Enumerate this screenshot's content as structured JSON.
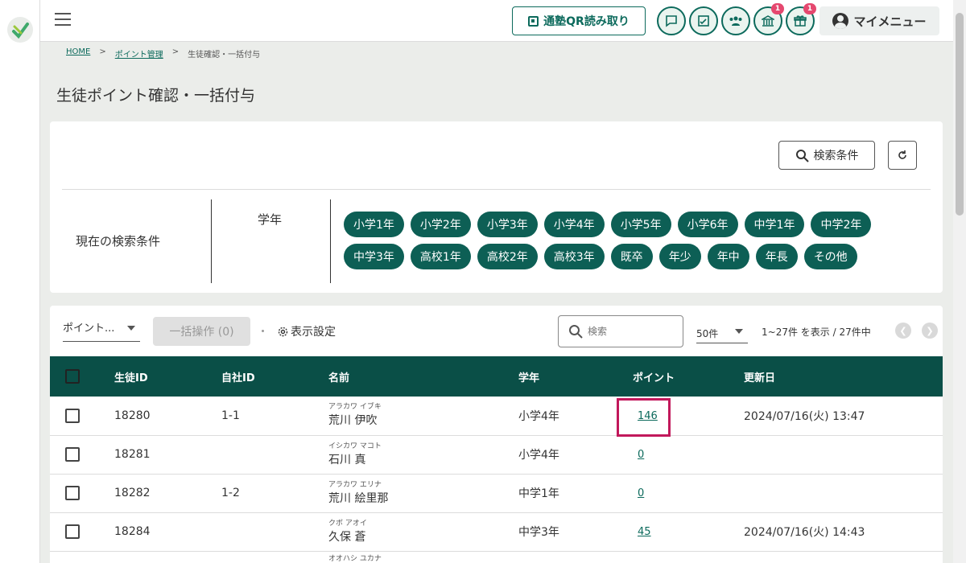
{
  "topbar": {
    "qr_button": "通塾QR読み取り",
    "badges": {
      "notice": "1",
      "gift": "1"
    },
    "my_menu": "マイメニュー"
  },
  "breadcrumb": {
    "home": "HOME",
    "sep": ">",
    "point_admin": "ポイント管理",
    "current": "生徒確認・一括付与"
  },
  "page_title": "生徒ポイント確認・一括付与",
  "filter": {
    "search_button": "検索条件",
    "current_label": "現在の検索条件",
    "grade_label": "学年",
    "grades": [
      "小学1年",
      "小学2年",
      "小学3年",
      "小学4年",
      "小学5年",
      "小学6年",
      "中学1年",
      "中学2年",
      "中学3年",
      "高校1年",
      "高校2年",
      "高校3年",
      "既卒",
      "年少",
      "年中",
      "年長",
      "その他"
    ]
  },
  "toolbar": {
    "point_select": "ポイント...",
    "bulk_button": "一括操作 (0)",
    "display_setting": "表示設定",
    "search_placeholder": "検索",
    "per_page": "50件",
    "range": "1~27件 を表示 / 27件中"
  },
  "table": {
    "headers": {
      "student_id": "生徒ID",
      "company_id": "自社ID",
      "name": "名前",
      "grade": "学年",
      "points": "ポイント",
      "updated": "更新日"
    },
    "rows": [
      {
        "student_id": "18280",
        "company_id": "1-1",
        "kana": "アラカワ イブキ",
        "name": "荒川 伊吹",
        "grade": "小学4年",
        "points": "146",
        "updated": "2024/07/16(火) 13:47"
      },
      {
        "student_id": "18281",
        "company_id": "",
        "kana": "イシカワ マコト",
        "name": "石川 真",
        "grade": "小学4年",
        "points": "0",
        "updated": ""
      },
      {
        "student_id": "18282",
        "company_id": "1-2",
        "kana": "アラカワ エリナ",
        "name": "荒川 絵里那",
        "grade": "中学1年",
        "points": "0",
        "updated": ""
      },
      {
        "student_id": "18284",
        "company_id": "",
        "kana": "クボ アオイ",
        "name": "久保 蒼",
        "grade": "中学3年",
        "points": "45",
        "updated": "2024/07/16(火) 14:43"
      },
      {
        "student_id": "",
        "company_id": "",
        "kana": "オオハシ ユカナ",
        "name": "",
        "grade": "",
        "points": "",
        "updated": ""
      }
    ]
  },
  "colors": {
    "primary": "#0a4f47",
    "chip": "#0d5f55",
    "highlight": "#c2185b",
    "badge": "#e5486f"
  }
}
